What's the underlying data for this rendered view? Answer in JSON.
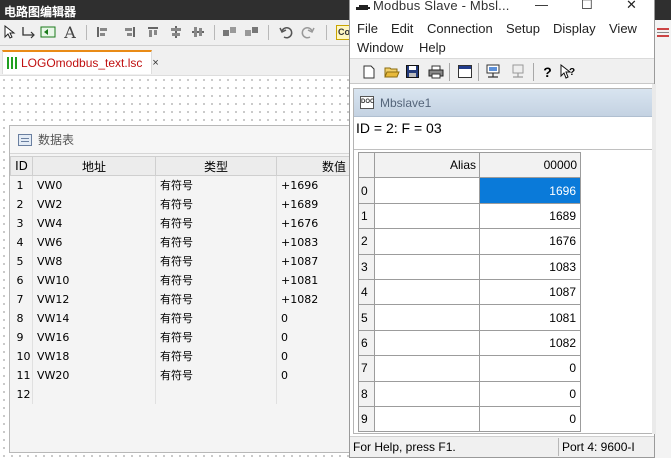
{
  "editor": {
    "title": "电路图编辑器",
    "toolbar_icons": [
      "select-arrow-icon",
      "connect-icon",
      "block-icon",
      "text-icon",
      "align-icon",
      "align-icon",
      "align-icon",
      "align-icon",
      "align-icon",
      "align-icon",
      "undo-icon",
      "redo-icon",
      "co-icon"
    ],
    "co_label": "Co",
    "document_tab": {
      "label": "LOGOmodbus_text.lsc",
      "close": "×"
    }
  },
  "data_table": {
    "title": "数据表",
    "columns": [
      "ID",
      "地址",
      "类型",
      "数值"
    ],
    "rows": [
      {
        "id": "1",
        "address": "VW0",
        "type": "有符号",
        "value": "+1696"
      },
      {
        "id": "2",
        "address": "VW2",
        "type": "有符号",
        "value": "+1689"
      },
      {
        "id": "3",
        "address": "VW4",
        "type": "有符号",
        "value": "+1676"
      },
      {
        "id": "4",
        "address": "VW6",
        "type": "有符号",
        "value": "+1083"
      },
      {
        "id": "5",
        "address": "VW8",
        "type": "有符号",
        "value": "+1087"
      },
      {
        "id": "6",
        "address": "VW10",
        "type": "有符号",
        "value": "+1081"
      },
      {
        "id": "7",
        "address": "VW12",
        "type": "有符号",
        "value": "+1082"
      },
      {
        "id": "8",
        "address": "VW14",
        "type": "有符号",
        "value": "0"
      },
      {
        "id": "9",
        "address": "VW16",
        "type": "有符号",
        "value": "0"
      },
      {
        "id": "10",
        "address": "VW18",
        "type": "有符号",
        "value": "0"
      },
      {
        "id": "11",
        "address": "VW20",
        "type": "有符号",
        "value": "0"
      },
      {
        "id": "12",
        "address": "",
        "type": "",
        "value": ""
      }
    ]
  },
  "modbus": {
    "title": "Modbus Slave - Mbsl...",
    "window_buttons": [
      "—",
      "☐",
      "✕"
    ],
    "menu": [
      "File",
      "Edit",
      "Connection",
      "Setup",
      "Display",
      "View",
      "Window",
      "Help"
    ],
    "toolbar_icons": [
      "new-document-icon",
      "open-folder-icon",
      "save-icon",
      "print-icon",
      "window-icon",
      "connect-icon",
      "disconnect-icon",
      "help-icon",
      "context-help-icon"
    ],
    "child_window_title": "Mbslave1",
    "id_line": "ID = 2: F = 03",
    "grid": {
      "alias_header": "Alias",
      "column_header": "00000",
      "selected_row": 0,
      "rows": [
        {
          "index": "0",
          "value": "1696"
        },
        {
          "index": "1",
          "value": "1689"
        },
        {
          "index": "2",
          "value": "1676"
        },
        {
          "index": "3",
          "value": "1083"
        },
        {
          "index": "4",
          "value": "1087"
        },
        {
          "index": "5",
          "value": "1081"
        },
        {
          "index": "6",
          "value": "1082"
        },
        {
          "index": "7",
          "value": "0"
        },
        {
          "index": "8",
          "value": "0"
        },
        {
          "index": "9",
          "value": "0"
        }
      ]
    },
    "status_left": "For Help, press F1.",
    "status_right": "Port 4: 9600-I"
  },
  "colors": {
    "selection": "#0a7ad9",
    "tab_accent": "#e98b16",
    "tab_label": "#c01010"
  }
}
